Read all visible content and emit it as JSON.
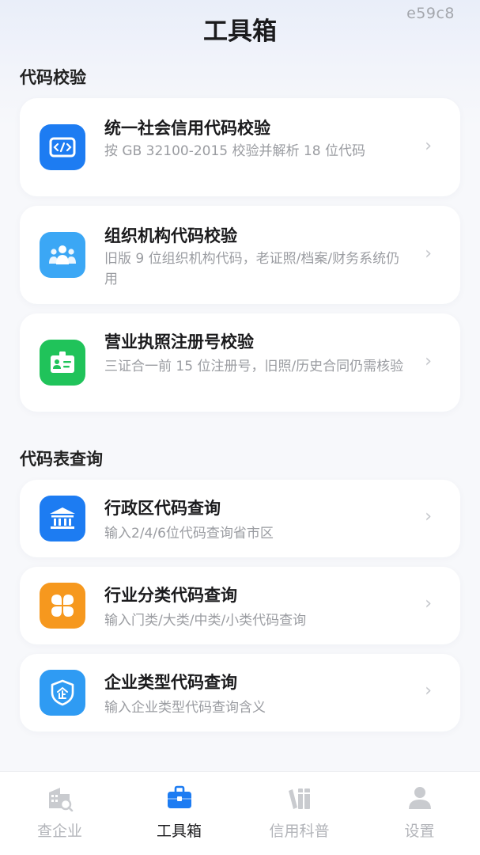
{
  "watermark": "e59c8",
  "header": {
    "title": "工具箱"
  },
  "sections": [
    {
      "title": "代码校验",
      "items": [
        {
          "title": "统一社会信用代码校验",
          "desc": "按 GB 32100-2015 校验并解析 18 位代码",
          "icon": "code-icon",
          "color": "#1d7cf2"
        },
        {
          "title": "组织机构代码校验",
          "desc": "旧版 9 位组织机构代码，老证照/档案/财务系统仍用",
          "icon": "people-group-icon",
          "color": "#3ba7f5"
        },
        {
          "title": "营业执照注册号校验",
          "desc": "三证合一前 15 位注册号，旧照/历史合同仍需核验",
          "icon": "id-card-icon",
          "color": "#20c35a"
        }
      ]
    },
    {
      "title": "代码表查询",
      "items": [
        {
          "title": "行政区代码查询",
          "desc": "输入2/4/6位代码查询省市区",
          "icon": "government-building-icon",
          "color": "#1d7cf2"
        },
        {
          "title": "行业分类代码查询",
          "desc": "输入门类/大类/中类/小类代码查询",
          "icon": "clover-icon",
          "color": "#f6981e"
        },
        {
          "title": "企业类型代码查询",
          "desc": "输入企业类型代码查询含义",
          "icon": "enterprise-shield-icon",
          "color": "#2f9bf3"
        }
      ]
    }
  ],
  "tabbar": {
    "items": [
      {
        "label": "查企业",
        "icon": "company-search-icon",
        "active": false
      },
      {
        "label": "工具箱",
        "icon": "toolbox-icon",
        "active": true
      },
      {
        "label": "信用科普",
        "icon": "books-icon",
        "active": false
      },
      {
        "label": "设置",
        "icon": "user-icon",
        "active": false
      }
    ]
  },
  "colors": {
    "accent": "#1d7cf2",
    "tab_inactive": "#b3b5ba",
    "background": "#f7f8fb"
  }
}
